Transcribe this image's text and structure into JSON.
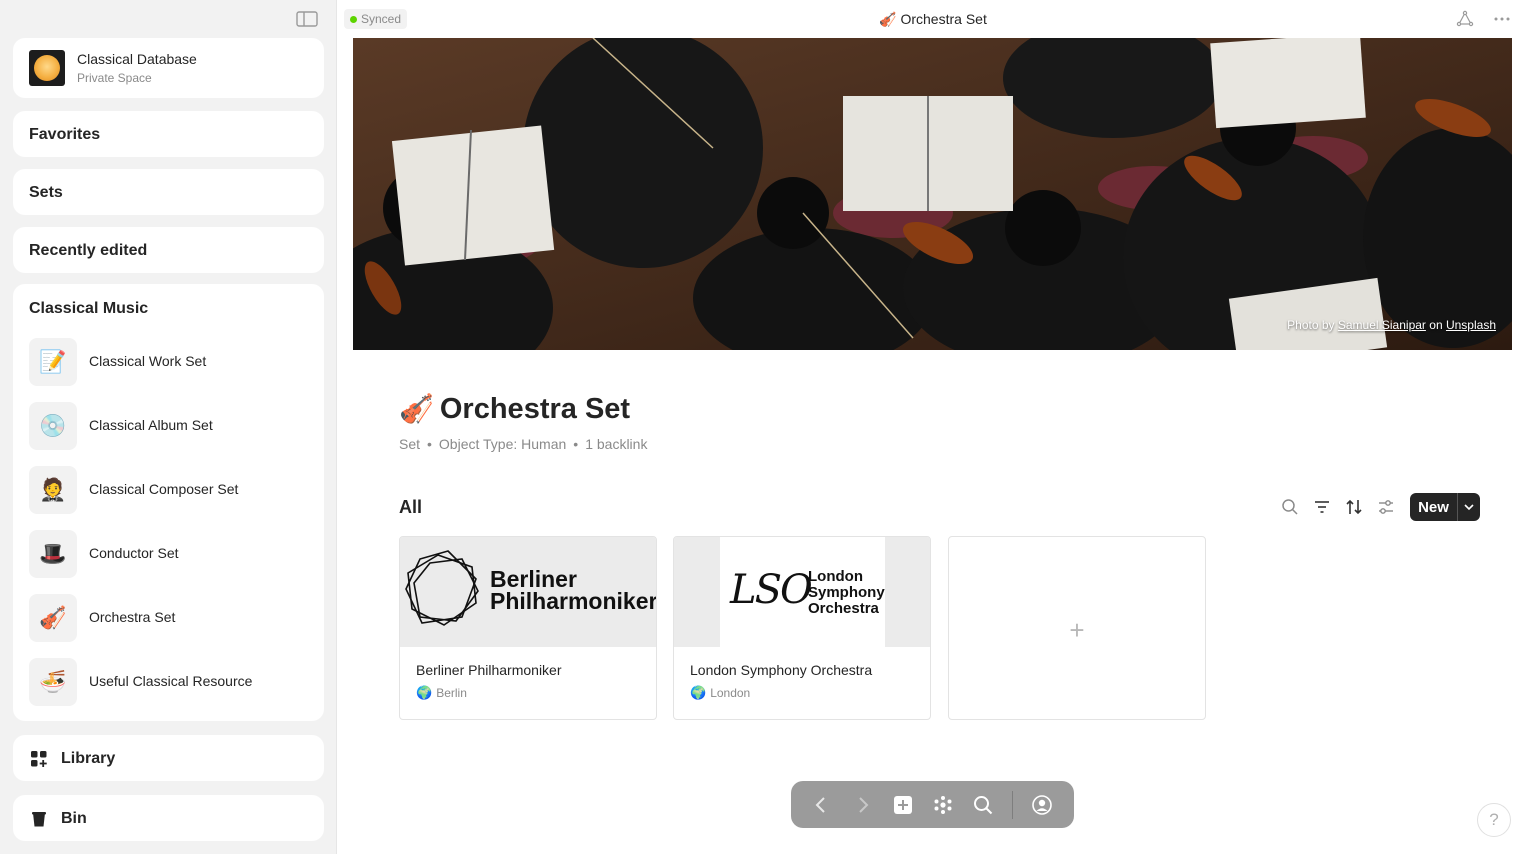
{
  "sidebar": {
    "space": {
      "name": "Classical Database",
      "type": "Private Space"
    },
    "sections": {
      "favorites": "Favorites",
      "sets": "Sets",
      "recently_edited": "Recently edited"
    },
    "widget": {
      "title": "Classical Music",
      "items": [
        {
          "label": "Classical Work Set",
          "icon": "📝"
        },
        {
          "label": "Classical Album Set",
          "icon": "💿"
        },
        {
          "label": "Classical Composer Set",
          "icon": "🤵"
        },
        {
          "label": "Conductor Set",
          "icon": "🎩"
        },
        {
          "label": "Orchestra Set",
          "icon": "🎻"
        },
        {
          "label": "Useful Classical Resource",
          "icon": "🍜"
        }
      ]
    },
    "library_label": "Library",
    "bin_label": "Bin"
  },
  "header": {
    "sync_status": "Synced",
    "title": "Orchestra Set",
    "title_icon": "🎻"
  },
  "cover": {
    "credit_prefix": "Photo by",
    "credit_author": "Samuel Sianipar",
    "credit_on": "on",
    "credit_site": "Unsplash"
  },
  "object": {
    "icon": "🎻",
    "title": "Orchestra Set",
    "featured": [
      "Set",
      "Object Type: Human",
      "1 backlink"
    ]
  },
  "view": {
    "title": "All",
    "new_label": "New",
    "cards": [
      {
        "name": "Berliner Philharmoniker",
        "relation": "Berlin",
        "logo_line1": "Berliner",
        "logo_line2": "Philharmoniker"
      },
      {
        "name": "London Symphony Orchestra",
        "relation": "London",
        "logo_line1": "London",
        "logo_line2": "Symphony",
        "logo_line3": "Orchestra",
        "logo_mark": "LSO"
      }
    ],
    "add_symbol": "+"
  },
  "help_label": "?"
}
